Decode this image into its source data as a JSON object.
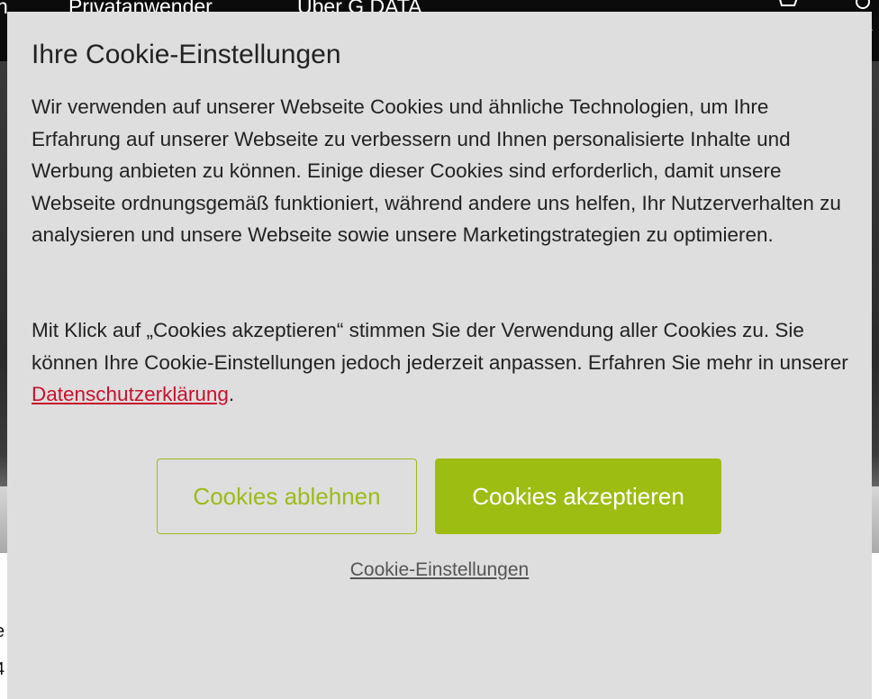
{
  "background": {
    "nav": [
      "n",
      "Privatanwender",
      "Über G DATA"
    ],
    "edge_text": [
      "e",
      "4"
    ]
  },
  "dialog": {
    "title": "Ihre Cookie-Einstellungen",
    "paragraph1": "Wir verwenden auf unserer Webseite Cookies und ähnliche Technologien, um Ihre Erfahrung auf unserer Webseite zu verbessern und Ihnen personalisierte Inhalte und Werbung anbieten zu können. Einige dieser Cookies sind erforderlich, damit unsere Webseite ordnungsgemäß funktioniert, während andere uns helfen, Ihr Nutzerverhalten zu analysieren und unsere Webseite sowie unsere Marketingstrategien zu optimieren.",
    "paragraph2_text": "Mit Klick auf „Cookies akzeptieren“ stimmen Sie der Verwendung aller Cookies zu. Sie können Ihre Cookie-Einstellungen jedoch jederzeit anpassen. Erfahren Sie mehr in unserer ",
    "privacy_link": "Datenschutzerklärung",
    "paragraph2_end": ".",
    "decline_label": "Cookies ablehnen",
    "accept_label": "Cookies akzeptieren",
    "settings_label": "Cookie-Einstellungen"
  },
  "colors": {
    "dialog_bg": "#dedede",
    "accent_green": "#9dbd13",
    "link_red": "#c8102e",
    "header_bg": "#0b0b0b"
  },
  "icons": [
    "cart-icon",
    "user-icon"
  ]
}
